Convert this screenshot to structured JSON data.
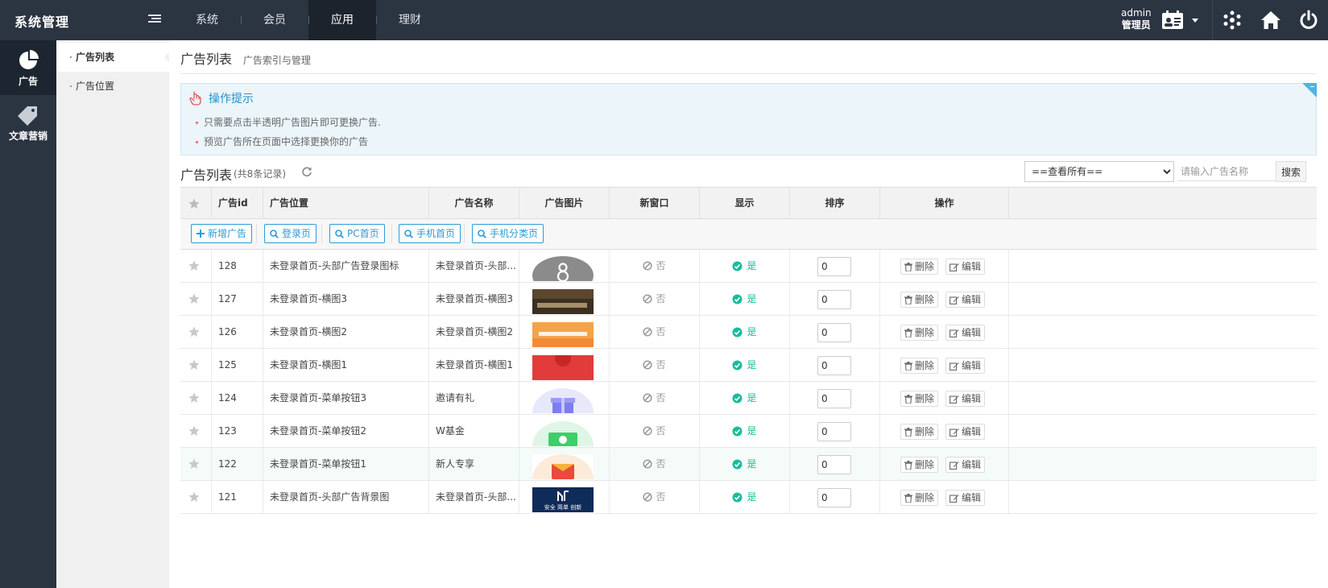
{
  "app": {
    "title": "系统管理",
    "top_nav": [
      {
        "label": "系统",
        "active": false
      },
      {
        "label": "会员",
        "active": false
      },
      {
        "label": "应用",
        "active": true
      },
      {
        "label": "理财",
        "active": false
      }
    ],
    "user": {
      "name": "admin",
      "role": "管理员"
    }
  },
  "icons": {
    "menu_toggle": "menu-fold-icon",
    "user_card": "user-card-icon",
    "dropdown": "caret-down-icon",
    "sitemap": "sitemap-icon",
    "home": "home-icon",
    "logout": "power-icon"
  },
  "rail": [
    {
      "label": "广告",
      "icon": "pie-chart-icon",
      "active": true
    },
    {
      "label": "文章营销",
      "icon": "tag-icon",
      "active": false
    }
  ],
  "subnav": [
    {
      "label": "广告列表",
      "active": true
    },
    {
      "label": "广告位置",
      "active": false
    }
  ],
  "page": {
    "title": "广告列表",
    "subtitle": "广告索引与管理"
  },
  "tips": {
    "title": "操作提示",
    "lines": [
      "只需要点击半透明广告图片即可更换广告.",
      "预览广告所在页面中选择更换你的广告"
    ]
  },
  "list": {
    "title": "广告列表",
    "count": "(共8条记录)",
    "filter_selected": "==查看所有==",
    "search_placeholder": "请输入广告名称",
    "search_button": "搜索"
  },
  "columns": {
    "id": "广告id",
    "position": "广告位置",
    "name": "广告名称",
    "image": "广告图片",
    "new_window": "新窗口",
    "show": "显示",
    "sort": "排序",
    "actions": "操作"
  },
  "toolbar": {
    "add": "新增广告",
    "filters": [
      "登录页",
      "PC首页",
      "手机首页",
      "手机分类页"
    ]
  },
  "row_labels": {
    "no": "否",
    "yes": "是",
    "delete": "删除",
    "edit": "编辑"
  },
  "colors": {
    "accent": "#2e9ad8",
    "success": "#1bbc9b",
    "topbar": "#2b3441"
  },
  "rows": [
    {
      "id": "128",
      "position": "未登录首页-头部广告登录图标",
      "name": "未登录首页-头部...",
      "sort": "0",
      "thumb": "avatar-8"
    },
    {
      "id": "127",
      "position": "未登录首页-横图3",
      "name": "未登录首页-横图3",
      "sort": "0",
      "thumb": "dark-banner"
    },
    {
      "id": "126",
      "position": "未登录首页-横图2",
      "name": "未登录首页-横图2",
      "sort": "0",
      "thumb": "orange-banner"
    },
    {
      "id": "125",
      "position": "未登录首页-横图1",
      "name": "未登录首页-横图1",
      "sort": "0",
      "thumb": "red-banner"
    },
    {
      "id": "124",
      "position": "未登录首页-菜单按钮3",
      "name": "邀请有礼",
      "sort": "0",
      "thumb": "gift"
    },
    {
      "id": "123",
      "position": "未登录首页-菜单按钮2",
      "name": "W基金",
      "sort": "0",
      "thumb": "fund"
    },
    {
      "id": "122",
      "position": "未登录首页-菜单按钮1",
      "name": "新人专享",
      "sort": "0",
      "thumb": "redpacket"
    },
    {
      "id": "121",
      "position": "未登录首页-头部广告背景图",
      "name": "未登录首页-头部...",
      "sort": "0",
      "thumb": "logo-banner",
      "thumb_text": "安全 简单 创新"
    }
  ]
}
